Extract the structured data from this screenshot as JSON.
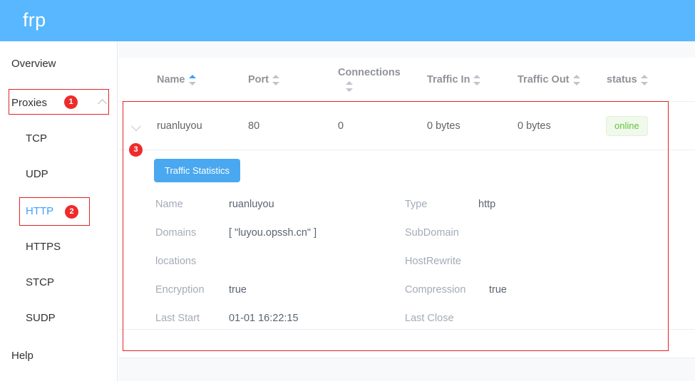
{
  "header": {
    "brand": "frp"
  },
  "sidebar": {
    "items": [
      {
        "label": "Overview",
        "level": "root",
        "active": false
      },
      {
        "label": "Proxies",
        "level": "root",
        "active": false,
        "badge": "1",
        "chevron": "chevron-up-icon"
      },
      {
        "label": "TCP",
        "level": "sub",
        "active": false
      },
      {
        "label": "UDP",
        "level": "sub",
        "active": false
      },
      {
        "label": "HTTP",
        "level": "sub",
        "active": true,
        "badge": "2"
      },
      {
        "label": "HTTPS",
        "level": "sub",
        "active": false
      },
      {
        "label": "STCP",
        "level": "sub",
        "active": false
      },
      {
        "label": "SUDP",
        "level": "sub",
        "active": false
      },
      {
        "label": "Help",
        "level": "root",
        "active": false
      }
    ]
  },
  "annotations": {
    "markers": [
      {
        "id": "1",
        "target": "proxies-nav-item"
      },
      {
        "id": "2",
        "target": "http-nav-item"
      },
      {
        "id": "3",
        "target": "row-expander"
      }
    ]
  },
  "table": {
    "columns": [
      {
        "label": "Name",
        "sort": "asc"
      },
      {
        "label": "Port",
        "sort": "none"
      },
      {
        "label": "Connections",
        "sort": "none"
      },
      {
        "label": "Traffic In",
        "sort": "none"
      },
      {
        "label": "Traffic Out",
        "sort": "none"
      },
      {
        "label": "status",
        "sort": "none"
      }
    ],
    "rows": [
      {
        "name": "ruanluyou",
        "port": "80",
        "connections": "0",
        "traffic_in": "0 bytes",
        "traffic_out": "0 bytes",
        "status": "online",
        "expanded": true
      }
    ]
  },
  "detail": {
    "traffic_button": "Traffic Statistics",
    "fields": [
      {
        "label": "Name",
        "value": "ruanluyou",
        "col": "left"
      },
      {
        "label": "Type",
        "value": "http",
        "col": "right"
      },
      {
        "label": "Domains",
        "value": "[ \"luyou.opssh.cn\" ]",
        "col": "left"
      },
      {
        "label": "SubDomain",
        "value": "",
        "col": "right"
      },
      {
        "label": "locations",
        "value": "",
        "col": "left"
      },
      {
        "label": "HostRewrite",
        "value": "",
        "col": "right"
      },
      {
        "label": "Encryption",
        "value": "true",
        "col": "left"
      },
      {
        "label": "Compression",
        "value": "true",
        "col": "right"
      },
      {
        "label": "Last Start",
        "value": "01-01 16:22:15",
        "col": "left"
      },
      {
        "label": "Last Close",
        "value": "",
        "col": "right"
      }
    ]
  },
  "colors": {
    "brand_blue": "#58b7ff",
    "accent_blue": "#409eff",
    "annotation_red": "#e02424",
    "status_green": "#67c23a",
    "status_green_bg": "#f0f9eb"
  }
}
